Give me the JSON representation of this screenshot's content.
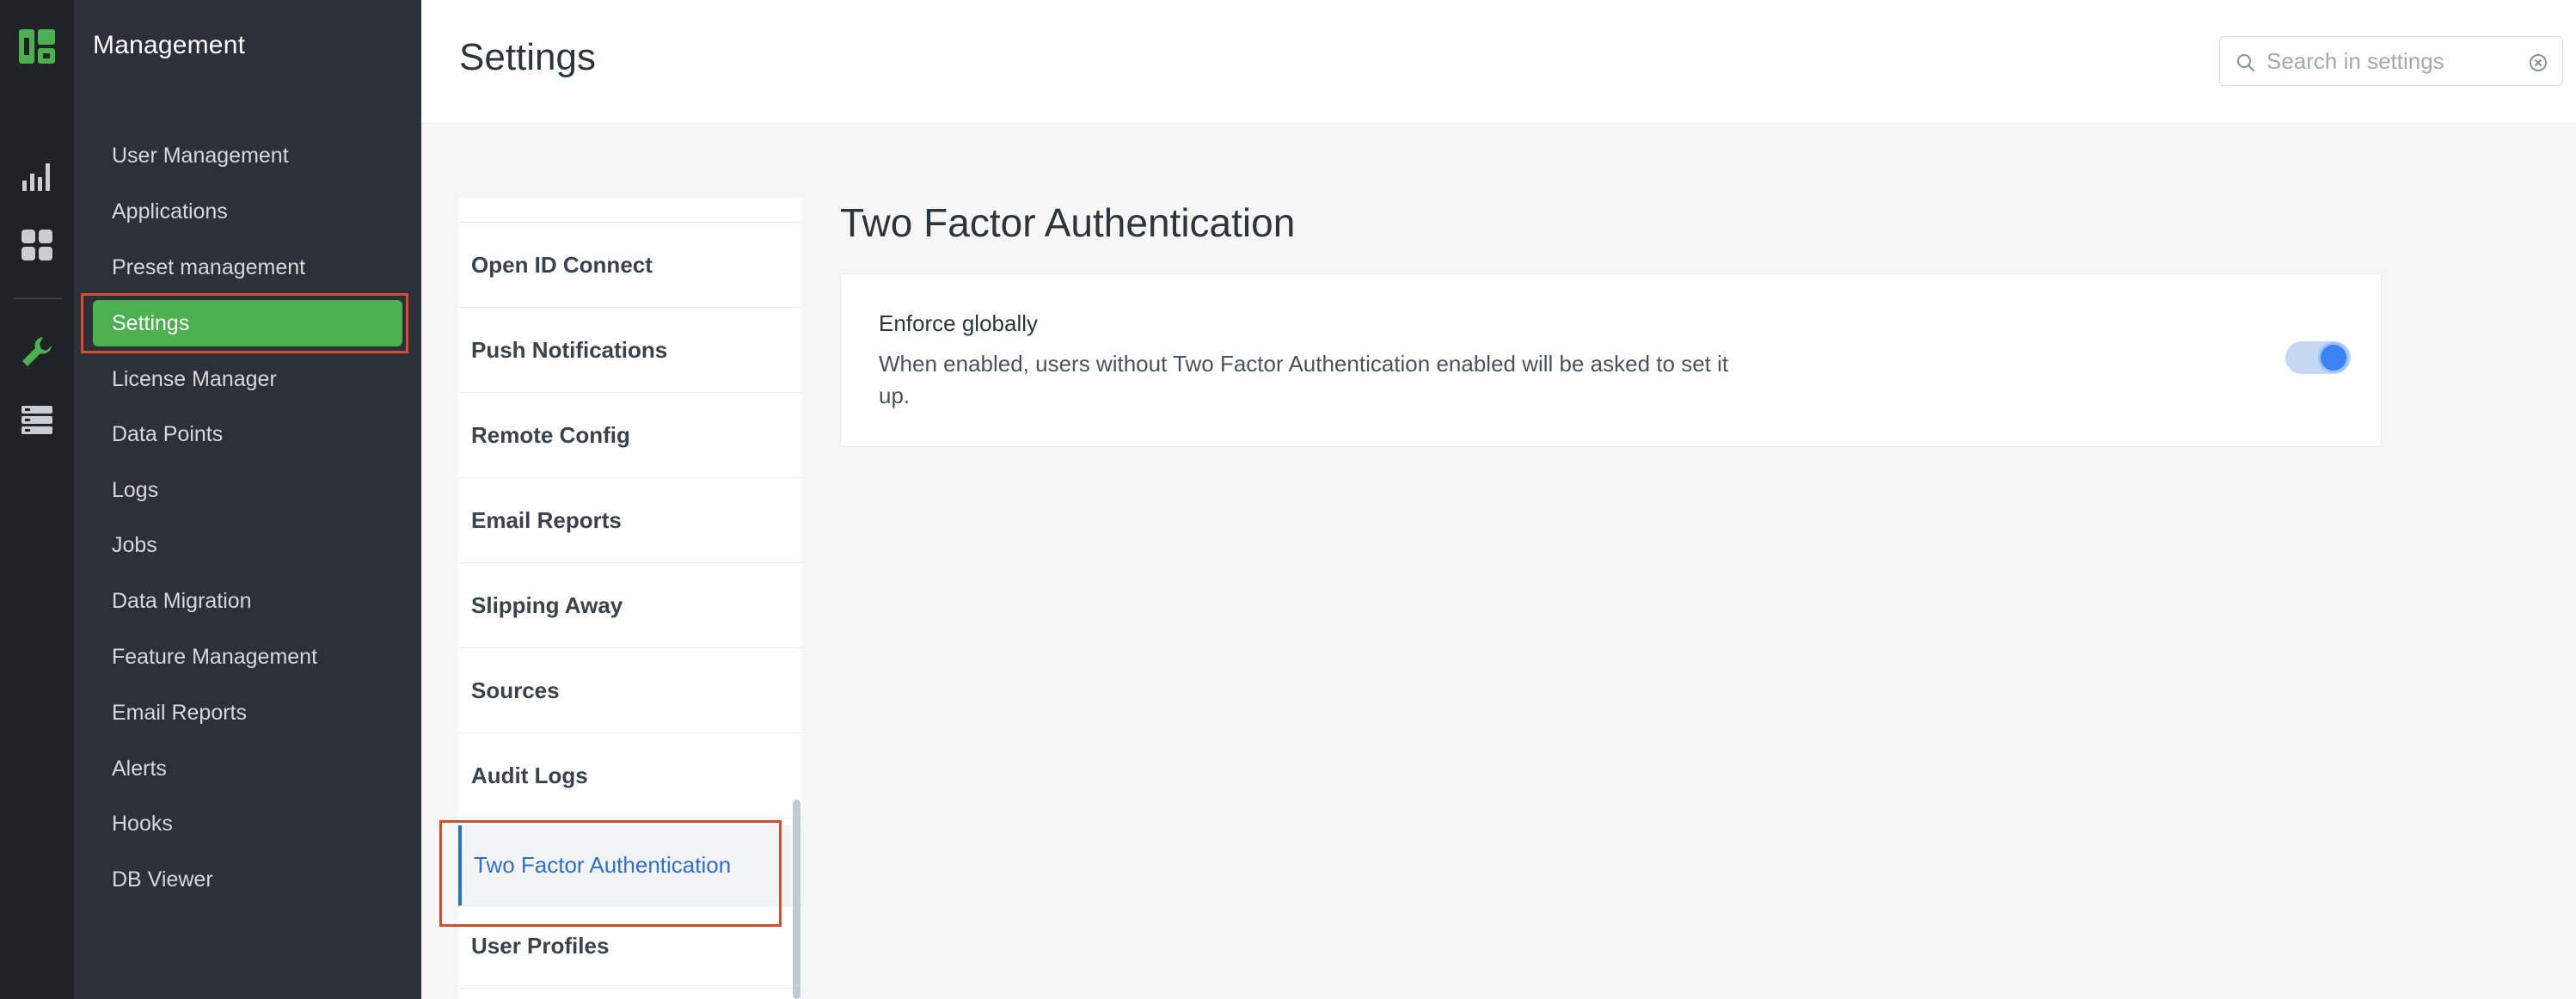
{
  "rail": {
    "icons": [
      "app-logo",
      "analytics-icon",
      "dashboard-icon",
      "wrench-icon",
      "server-icon"
    ],
    "colors": {
      "background": "#1f2328",
      "accent": "#4caf50"
    }
  },
  "sidebar": {
    "title": "Management",
    "items": [
      {
        "label": "User Management"
      },
      {
        "label": "Applications"
      },
      {
        "label": "Preset management"
      },
      {
        "label": "Settings",
        "active": true
      },
      {
        "label": "License Manager"
      },
      {
        "label": "Data Points"
      },
      {
        "label": "Logs"
      },
      {
        "label": "Jobs"
      },
      {
        "label": "Data Migration"
      },
      {
        "label": "Feature Management"
      },
      {
        "label": "Email Reports"
      },
      {
        "label": "Alerts"
      },
      {
        "label": "Hooks"
      },
      {
        "label": "DB Viewer"
      }
    ]
  },
  "header": {
    "title": "Settings",
    "search_placeholder": "Search in settings",
    "search_value": ""
  },
  "settings_list": {
    "items": [
      {
        "label": "Open ID Connect"
      },
      {
        "label": "Push Notifications"
      },
      {
        "label": "Remote Config"
      },
      {
        "label": "Email Reports"
      },
      {
        "label": "Slipping Away"
      },
      {
        "label": "Sources"
      },
      {
        "label": "Audit Logs"
      },
      {
        "label": "Two Factor Authentication",
        "active": true
      },
      {
        "label": "User Profiles"
      }
    ]
  },
  "detail": {
    "title": "Two Factor Authentication",
    "setting": {
      "label": "Enforce globally",
      "description": "When enabled, users without Two Factor Authentication enabled will be asked to set it up.",
      "enabled": true
    }
  },
  "colors": {
    "active_sidebar": "#4caf50",
    "active_list": "#2b6ed8",
    "highlight_box": "#d94a2f",
    "toggle_on": "#3b82f6"
  }
}
